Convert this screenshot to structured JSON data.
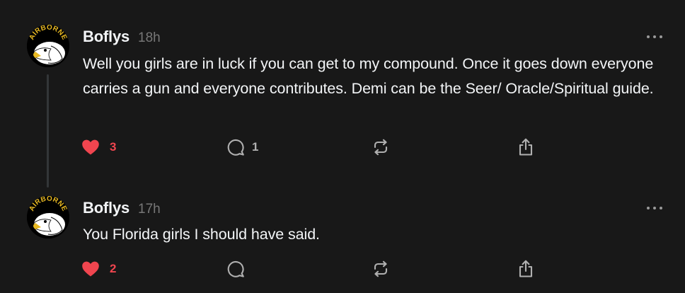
{
  "colors": {
    "background": "#181818",
    "text_primary": "#f3f5f7",
    "text_secondary": "#777777",
    "like_red": "#f0454f",
    "icon_gray": "#b0b0b0"
  },
  "posts": [
    {
      "username": "Boflys",
      "timestamp": "18h",
      "avatar_text": "AIRBORNE",
      "avatar_icon": "airborne-eagle-patch",
      "text": "Well you girls are in luck if you can get to my compound. Once it goes down everyone carries a gun and everyone contributes. Demi can be the Seer/ Oracle/Spiritual guide.",
      "likes": "3",
      "liked": true,
      "replies": "1"
    },
    {
      "username": "Boflys",
      "timestamp": "17h",
      "avatar_text": "AIRBORNE",
      "avatar_icon": "airborne-eagle-patch",
      "text": "You Florida girls I should have said.",
      "likes": "2",
      "liked": true,
      "replies": ""
    }
  ]
}
